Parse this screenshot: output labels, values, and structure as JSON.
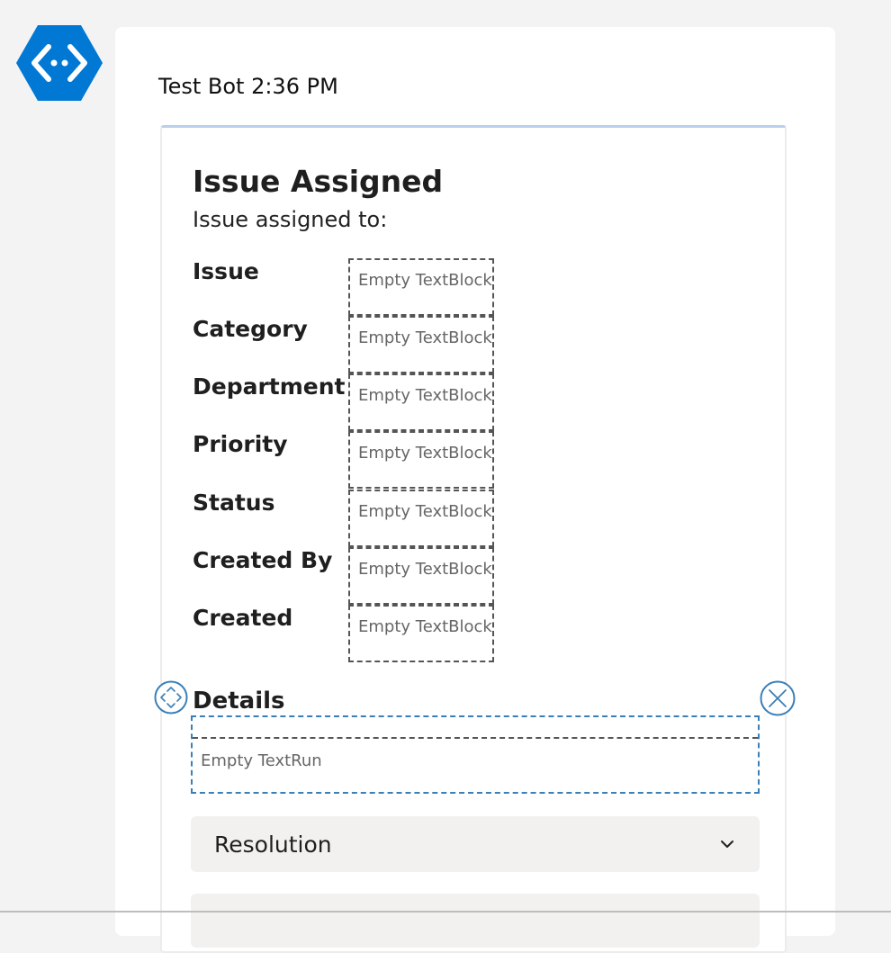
{
  "message": {
    "sender": "Test Bot",
    "time": "2:36 PM",
    "sender_line": "Test Bot 2:36 PM"
  },
  "card": {
    "title": "Issue Assigned",
    "subtitle": "Issue assigned to:",
    "facts": [
      {
        "label": "Issue",
        "value": "Empty TextBlock"
      },
      {
        "label": "Category",
        "value": "Empty TextBlock"
      },
      {
        "label": "Department",
        "value": "Empty TextBlock"
      },
      {
        "label": "Priority",
        "value": "Empty TextBlock"
      },
      {
        "label": "Status",
        "value": "Empty TextBlock"
      },
      {
        "label": "Created By",
        "value": "Empty TextBlock"
      },
      {
        "label": "Created",
        "value": "Empty TextBlock"
      }
    ],
    "details_heading": "Details",
    "details_placeholder": "Empty TextRun",
    "resolution_select": {
      "selected": "Resolution"
    }
  },
  "icons": {
    "avatar": "bot-logo-icon",
    "move": "move-arrows-icon",
    "remove": "close-circle-icon",
    "dropdown": "chevron-down-icon"
  },
  "colors": {
    "brand_blue": "#0078d4",
    "selection_blue": "#3a7fb7",
    "card_accent": "#b8d0ea"
  }
}
